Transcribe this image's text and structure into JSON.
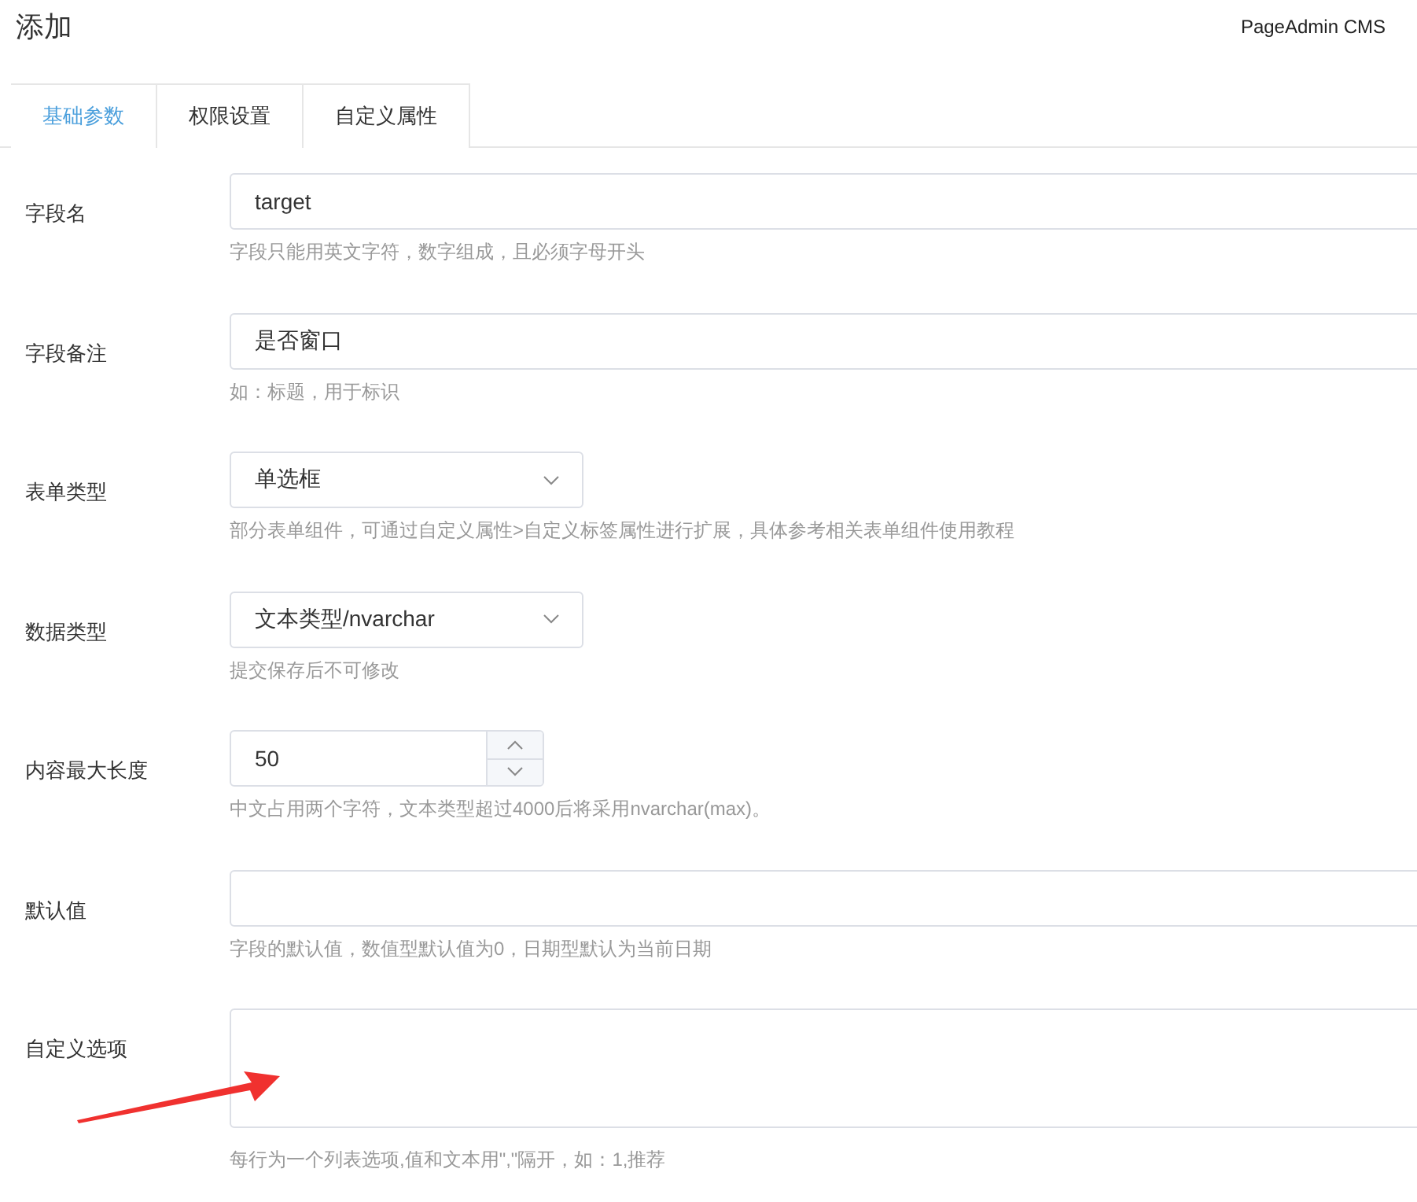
{
  "page_title": "添加",
  "brand": "PageAdmin CMS",
  "tabs": [
    {
      "label": "基础参数",
      "selected": true
    },
    {
      "label": "权限设置",
      "selected": false
    },
    {
      "label": "自定义属性",
      "selected": false
    }
  ],
  "fields": [
    {
      "label": "字段名",
      "kind": "text",
      "value": "target",
      "hint": "字段只能用英文字符，数字组成，且必须字母开头"
    },
    {
      "label": "字段备注",
      "kind": "text",
      "value": "是否窗口",
      "hint": "如：标题，用于标识"
    },
    {
      "label": "表单类型",
      "kind": "select",
      "value": "单选框",
      "hint": "部分表单组件，可通过自定义属性>自定义标签属性进行扩展，具体参考相关表单组件使用教程"
    },
    {
      "label": "数据类型",
      "kind": "select",
      "value": "文本类型/nvarchar",
      "hint": "提交保存后不可修改"
    },
    {
      "label": "内容最大长度",
      "kind": "number",
      "value": "50",
      "hint": "中文占用两个字符，文本类型超过4000后将采用nvarchar(max)。"
    },
    {
      "label": "默认值",
      "kind": "text",
      "hint": "字段的默认值，数值型默认值为0，日期型默认为当前日期"
    },
    {
      "label": "自定义选项",
      "kind": "textarea",
      "hint": "每行为一个列表选项,值和文本用\",\"隔开，如：1,推荐"
    }
  ]
}
